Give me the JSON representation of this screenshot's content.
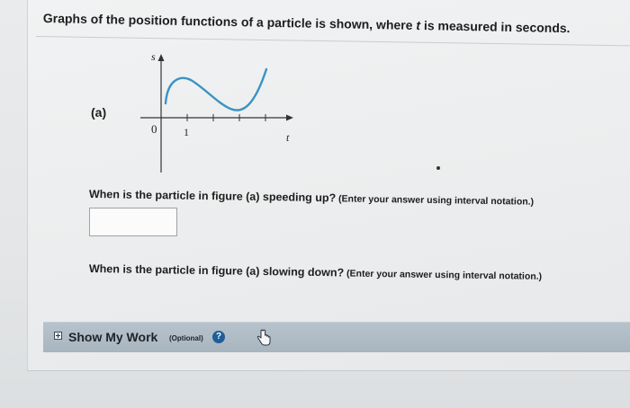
{
  "question": {
    "prompt_before": "Graphs of the position functions of a particle is shown, where ",
    "prompt_var": "t",
    "prompt_after": " is measured in seconds.",
    "part_label": "(a)"
  },
  "graph": {
    "y_axis_label": "s",
    "x_axis_label": "t",
    "origin_label": "0",
    "tick_label": "1",
    "curve_color": "#3b93c2"
  },
  "q1": {
    "text": "When is the particle in figure (a) speeding up?",
    "note": " (Enter your answer using interval notation.)",
    "answer_value": ""
  },
  "q2": {
    "text": "When is the particle in figure (a) slowing down?",
    "note": " (Enter your answer using interval notation.)"
  },
  "work": {
    "label": "Show My Work",
    "optional": "(Optional)",
    "help_icon": "?"
  }
}
